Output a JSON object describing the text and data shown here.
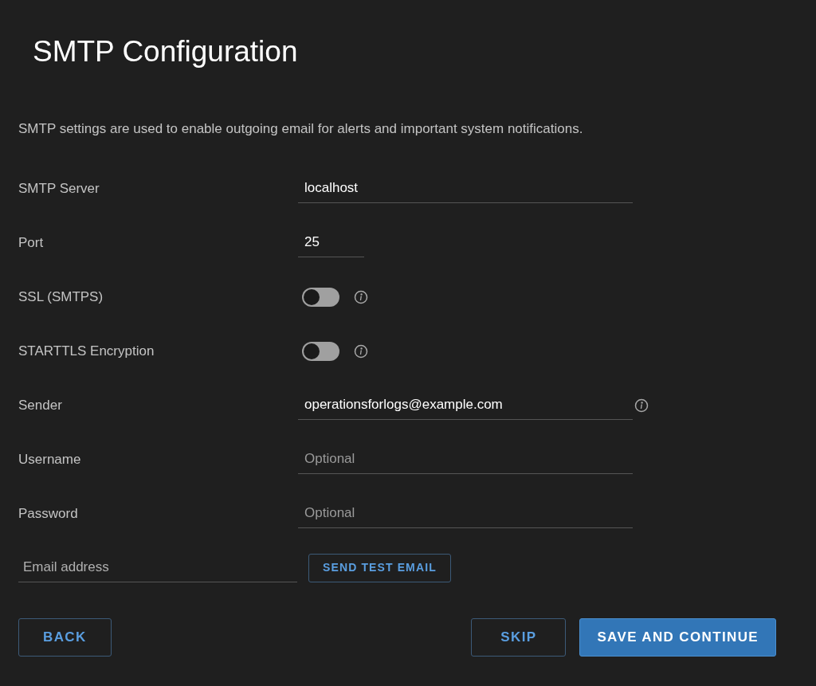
{
  "title": "SMTP Configuration",
  "description": "SMTP settings are used to enable outgoing email for alerts and important system notifications.",
  "fields": [
    {
      "kind": "text",
      "label": "SMTP Server",
      "value": "localhost",
      "info": false
    },
    {
      "kind": "short-text",
      "label": "Port",
      "value": "25",
      "info": false
    },
    {
      "kind": "toggle",
      "label": "SSL (SMTPS)",
      "on": false,
      "info": true
    },
    {
      "kind": "toggle",
      "label": "STARTTLS Encryption",
      "on": false,
      "info": true
    },
    {
      "kind": "text",
      "label": "Sender",
      "value": "operationsforlogs@example.com",
      "info": true
    },
    {
      "kind": "text",
      "label": "Username",
      "placeholder": "Optional",
      "info": false
    },
    {
      "kind": "text",
      "label": "Password",
      "placeholder": "Optional",
      "info": false
    }
  ],
  "test_email": {
    "placeholder": "Email address",
    "button": "SEND TEST EMAIL"
  },
  "footer": {
    "left": [
      {
        "label": "BACK",
        "kind": "outline"
      }
    ],
    "right": [
      {
        "label": "SKIP",
        "kind": "outline"
      },
      {
        "label": "SAVE AND CONTINUE",
        "kind": "primary"
      }
    ]
  }
}
